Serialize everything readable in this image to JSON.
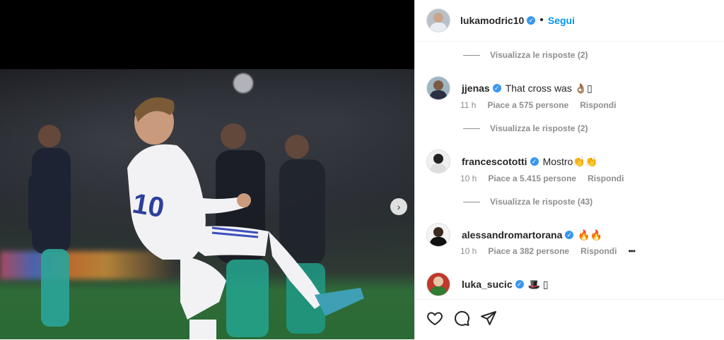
{
  "post": {
    "next_label": "›"
  },
  "header": {
    "username": "lukamodric10",
    "verified": "✓",
    "separator": "•",
    "follow": "Segui"
  },
  "comments": [
    {
      "replies": "Visualizza le risposte (2)"
    },
    {
      "username": "jjenas",
      "text": "That cross was 👌🏽⁠▯",
      "time": "11 h",
      "likes": "Piace a 575 persone",
      "reply": "Rispondi",
      "replies": "Visualizza le risposte (2)"
    },
    {
      "username": "francescototti",
      "text": "Mostro👏👏",
      "time": "10 h",
      "likes": "Piace a 5.415 persone",
      "reply": "Rispondi",
      "replies": "Visualizza le risposte (43)"
    },
    {
      "username": "alessandromartorana",
      "text": "🔥🔥",
      "time": "10 h",
      "likes": "Piace a 382 persone",
      "reply": "Rispondi",
      "more": "•••"
    },
    {
      "username": "luka_sucic",
      "text": "🎩 ▯"
    }
  ],
  "icons": [
    "heart-icon",
    "comment-icon",
    "share-icon",
    "chevron-right-icon",
    "verified-icon"
  ]
}
